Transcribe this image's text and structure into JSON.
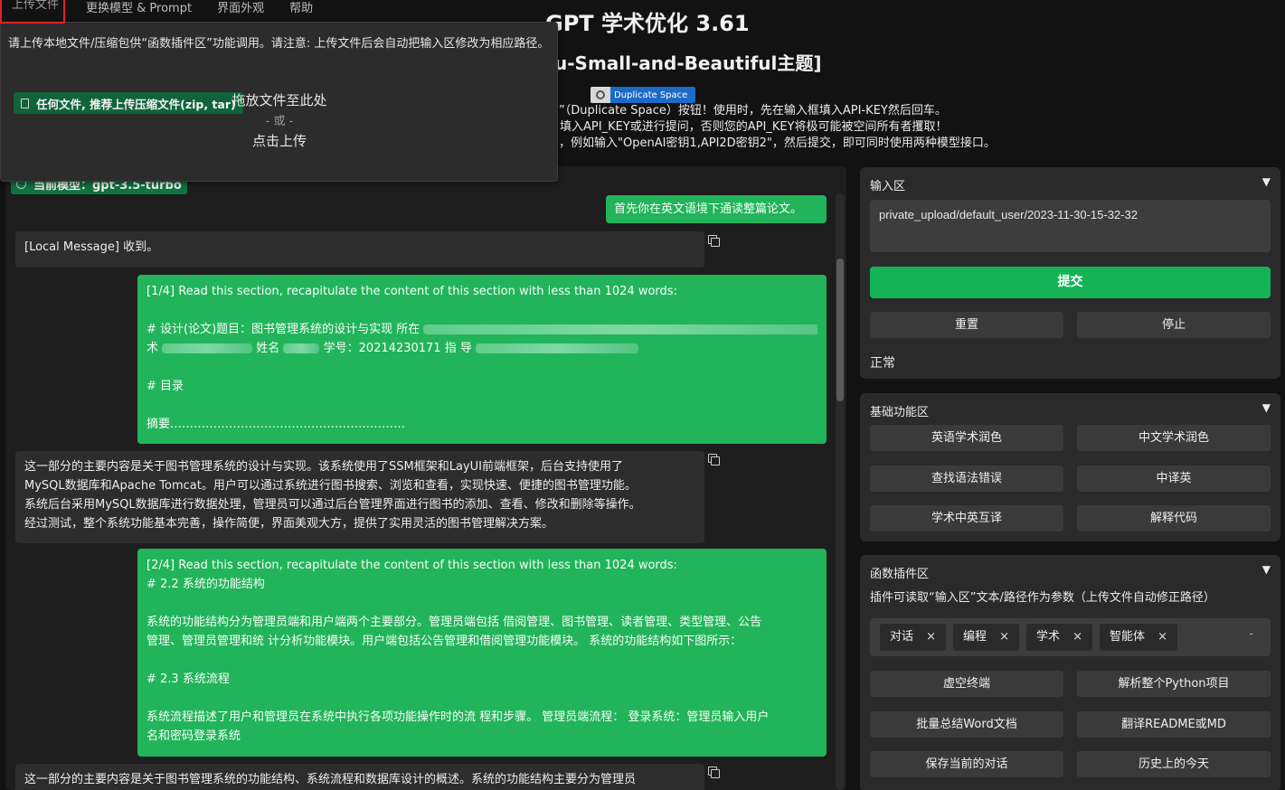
{
  "menu": [
    {
      "label": "上传文件"
    },
    {
      "label": "更换模型 & Prompt"
    },
    {
      "label": "界面外观"
    },
    {
      "label": "帮助"
    }
  ],
  "header": {
    "title": "GPT 学术优化 3.61",
    "subtitle": "u-Small-and-Beautiful主题]",
    "duplicate_badge": "Duplicate Space",
    "notices": [
      "”（Duplicate Space）按钮！使用时，先在输入框填入API-KEY然后回车。",
      "填入API_KEY或进行提问，否则您的API_KEY将极可能被空间所有者攫取！",
      "，例如输入\"OpenAI密钥1,API2D密钥2\"，然后提交，即可同时使用两种模型接口。"
    ]
  },
  "upload": {
    "description": "请上传本地文件/压缩包供“函数插件区”功能调用。请注意: 上传文件后会自动把输入区修改为相应路径。",
    "chip_label": "任何文件, 推荐上传压缩文件(zip, tar)",
    "drop_text": "拖放文件至此处",
    "or_text": "- 或 -",
    "click_text": "点击上传"
  },
  "chat": {
    "model_badge": "当前模型：gpt-3.5-turbo",
    "messages": [
      {
        "role": "user",
        "text": "首先你在英文语境下通读整篇论文。"
      },
      {
        "role": "bot",
        "text": "[Local Message] 收到。"
      },
      {
        "role": "user",
        "line1": "[1/4] Read this section, recapitulate the content of this section with less than 1024 words:",
        "line2": "# 设计(论文)题目：图书管理系统的设计与实现 所在",
        "line3": "术",
        "line3b": "姓名",
        "line3c": "学号：20214230171",
        "line3d": "指 导",
        "line4": "# 目录",
        "line5": "摘要……………………………………………………"
      },
      {
        "role": "bot",
        "text": "这一部分的主要内容是关于图书管理系统的设计与实现。该系统使用了SSM框架和LayUI前端框架，后台支持使用了\nMySQL数据库和Apache Tomcat。用户可以通过系统进行图书搜索、浏览和查看，实现快速、便捷的图书管理功能。\n系统后台采用MySQL数据库进行数据处理，管理员可以通过后台管理界面进行图书的添加、查看、修改和删除等操作。\n经过测试，整个系统功能基本完善，操作简便，界面美观大方，提供了实用灵活的图书管理解决方案。"
      },
      {
        "role": "user",
        "text": "[2/4] Read this section, recapitulate the content of this section with less than 1024 words:\n# 2.2 系统的功能结构\n\n系统的功能结构分为管理员端和用户端两个主要部分。管理员端包括 借阅管理、图书管理、读者管理、类型管理、公告\n管理、管理员管理和统 计分析功能模块。用户端包括公告管理和借阅管理功能模块。 系统的功能结构如下图所示：\n\n# 2.3 系统流程\n\n系统流程描述了用户和管理员在系统中执行各项功能操作时的流 程和步骤。 管理员端流程： 登录系统：管理员输入用户\n名和密码登录系统"
      },
      {
        "role": "bot",
        "text": "这一部分的主要内容是关于图书管理系统的功能结构、系统流程和数据库设计的概述。系统的功能结构主要分为管理员"
      }
    ]
  },
  "input_panel": {
    "title": "输入区",
    "toggle": "▼",
    "input_value": "private_upload/default_user/2023-11-30-15-32-32",
    "submit": "提交",
    "reset": "重置",
    "stop": "停止",
    "status": "正常"
  },
  "basic_panel": {
    "title": "基础功能区",
    "toggle": "▼",
    "buttons": [
      "英语学术润色",
      "中文学术润色",
      "查找语法错误",
      "中译英",
      "学术中英互译",
      "解释代码"
    ]
  },
  "plugin_panel": {
    "title": "函数插件区",
    "toggle": "▼",
    "hint": "插件可读取“输入区”文本/路径作为参数（上传文件自动修正路径）",
    "tags": [
      "对话",
      "编程",
      "学术",
      "智能体"
    ],
    "tag_close": "×",
    "dropdown": "-",
    "buttons": [
      "虚空终端",
      "解析整个Python项目",
      "批量总结Word文档",
      "翻译README或MD",
      "保存当前的对话",
      "历史上的今天"
    ]
  },
  "colors": {
    "accent_green": "#22b45a",
    "submit_green": "#14b456",
    "background": "#121212",
    "highlight_red": "#e02424"
  }
}
